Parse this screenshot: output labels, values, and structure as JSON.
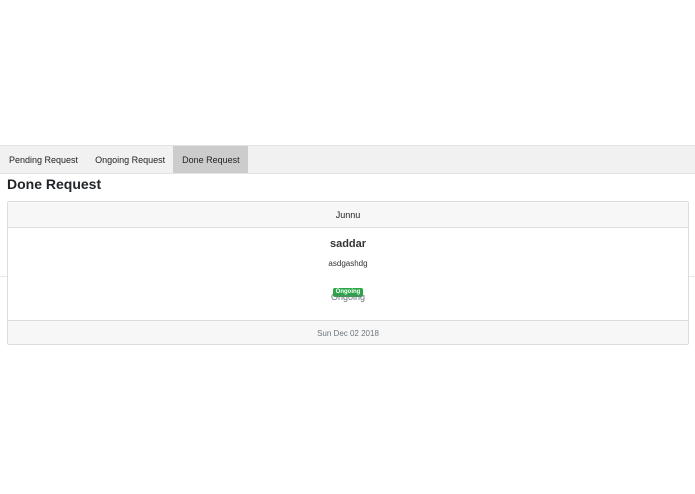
{
  "tabs": [
    {
      "label": "Pending Request"
    },
    {
      "label": "Ongoing Request"
    },
    {
      "label": "Done Request"
    }
  ],
  "active_tab": "Done Request",
  "page_title": "Done Request",
  "request_card": {
    "header": "Junnu",
    "title": "saddar",
    "description": "asdgashdg",
    "badge": "Ongoing",
    "status": "Ongoing",
    "date": "Sun Dec 02 2018"
  },
  "colors": {
    "badge_success": "#28a745",
    "active_tab_bg": "#cccccc",
    "tabbar_bg": "#f1f1f1"
  }
}
